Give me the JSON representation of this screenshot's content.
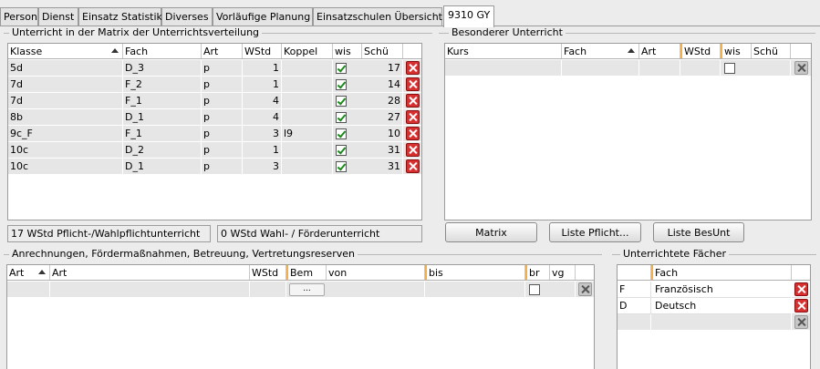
{
  "tabs": [
    "Person",
    "Dienst",
    "Einsatz Statistik",
    "Diverses",
    "Vorläufige Planung",
    "Einsatzschulen Übersicht",
    "9310 GY"
  ],
  "selected_tab": "9310 GY",
  "matrix": {
    "title": "Unterricht in der Matrix der Unterrichtsverteilung",
    "headers": [
      "Klasse",
      "Fach",
      "Art",
      "WStd",
      "Koppel",
      "wis",
      "Schü"
    ],
    "rows": [
      {
        "klasse": "5d",
        "fach": "D_3",
        "art": "p",
        "wstd": "1",
        "koppel": "",
        "wis": true,
        "schue": "17"
      },
      {
        "klasse": "7d",
        "fach": "F_2",
        "art": "p",
        "wstd": "1",
        "koppel": "",
        "wis": true,
        "schue": "14"
      },
      {
        "klasse": "7d",
        "fach": "F_1",
        "art": "p",
        "wstd": "4",
        "koppel": "",
        "wis": true,
        "schue": "28"
      },
      {
        "klasse": "8b",
        "fach": "D_1",
        "art": "p",
        "wstd": "4",
        "koppel": "",
        "wis": true,
        "schue": "27"
      },
      {
        "klasse": "9c_F",
        "fach": "F_1",
        "art": "p",
        "wstd": "3",
        "koppel": "l9",
        "wis": true,
        "schue": "10"
      },
      {
        "klasse": "10c",
        "fach": "D_2",
        "art": "p",
        "wstd": "1",
        "koppel": "",
        "wis": true,
        "schue": "31"
      },
      {
        "klasse": "10c",
        "fach": "D_1",
        "art": "p",
        "wstd": "3",
        "koppel": "",
        "wis": true,
        "schue": "31"
      }
    ],
    "summary_pflicht": "17 WStd Pflicht-/Wahlpflichtunterricht",
    "summary_wahl": "0 WStd Wahl- / Förderunterricht"
  },
  "besonderer": {
    "title": "Besonderer Unterricht",
    "headers": [
      "Kurs",
      "Fach",
      "Art",
      "WStd",
      "wis",
      "Schü"
    ],
    "buttons": [
      "Matrix",
      "Liste Pflicht...",
      "Liste BesUnt"
    ]
  },
  "anrechnungen": {
    "title": "Anrechnungen, Fördermaßnahmen, Betreuung, Vertretungsreserven",
    "headers": [
      "Art",
      "Art",
      "WStd",
      "Bem",
      "von",
      "bis",
      "br",
      "vg"
    ],
    "dots_label": "..."
  },
  "faecher": {
    "title": "Unterrichtete Fächer",
    "headers": [
      "",
      "Fach"
    ],
    "rows": [
      {
        "code": "F",
        "name": "Französisch"
      },
      {
        "code": "D",
        "name": "Deutsch"
      }
    ]
  }
}
